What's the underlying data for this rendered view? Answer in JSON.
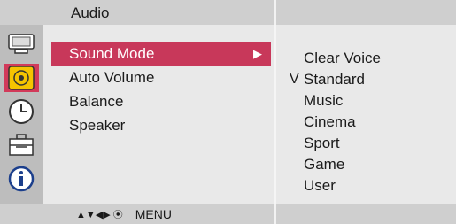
{
  "window": {
    "title": "Audio"
  },
  "sidebar": {
    "icons": [
      {
        "name": "monitor-icon",
        "selected": false
      },
      {
        "name": "speaker-icon",
        "selected": true
      },
      {
        "name": "clock-icon",
        "selected": false
      },
      {
        "name": "toolbox-icon",
        "selected": false
      },
      {
        "name": "info-icon",
        "selected": false
      }
    ]
  },
  "menu": {
    "items": [
      {
        "label": "Sound Mode",
        "selected": true,
        "arrow": "▶"
      },
      {
        "label": "Auto Volume",
        "selected": false
      },
      {
        "label": "Balance",
        "selected": false
      },
      {
        "label": "Speaker",
        "selected": false
      }
    ]
  },
  "options": {
    "check_glyph": "V",
    "items": [
      {
        "label": "Clear Voice",
        "checked": false
      },
      {
        "label": "Standard",
        "checked": true
      },
      {
        "label": "Music",
        "checked": false
      },
      {
        "label": "Cinema",
        "checked": false
      },
      {
        "label": "Sport",
        "checked": false
      },
      {
        "label": "Game",
        "checked": false
      },
      {
        "label": "User",
        "checked": false
      }
    ]
  },
  "footer": {
    "nav_glyphs": "▲▼◀▶ ⦿",
    "menu_label": "MENU"
  },
  "colors": {
    "highlight": "#c8385a",
    "icon_selected": "#d23a5a",
    "panel_bg": "#e9e9e9",
    "bar_bg": "#cfcfcf",
    "sidebar_bg": "#bdbdbd"
  }
}
